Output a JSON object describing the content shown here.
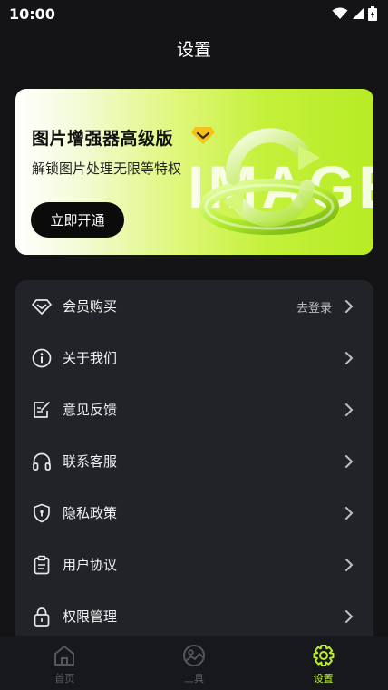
{
  "status": {
    "time": "10:00"
  },
  "nav": {
    "title": "设置"
  },
  "banner": {
    "title": "图片增强器高级版",
    "subtitle": "解锁图片处理无限等特权",
    "button_label": "立即开通",
    "watermark": "IMAGE"
  },
  "menu": {
    "items": [
      {
        "icon": "diamond-icon",
        "label": "会员购买",
        "value": "去登录"
      },
      {
        "icon": "info-icon",
        "label": "关于我们"
      },
      {
        "icon": "feedback-icon",
        "label": "意见反馈"
      },
      {
        "icon": "headphones-icon",
        "label": "联系客服"
      },
      {
        "icon": "shield-icon",
        "label": "隐私政策"
      },
      {
        "icon": "clipboard-icon",
        "label": "用户协议"
      },
      {
        "icon": "lock-icon",
        "label": "权限管理"
      }
    ]
  },
  "tabs": [
    {
      "icon": "home-icon",
      "label": "首页",
      "active": false
    },
    {
      "icon": "tools-icon",
      "label": "工具",
      "active": false
    },
    {
      "icon": "settings-icon",
      "label": "设置",
      "active": true
    }
  ],
  "colors": {
    "accent": "#b8ee2a",
    "background": "#141416",
    "card": "#222328"
  }
}
